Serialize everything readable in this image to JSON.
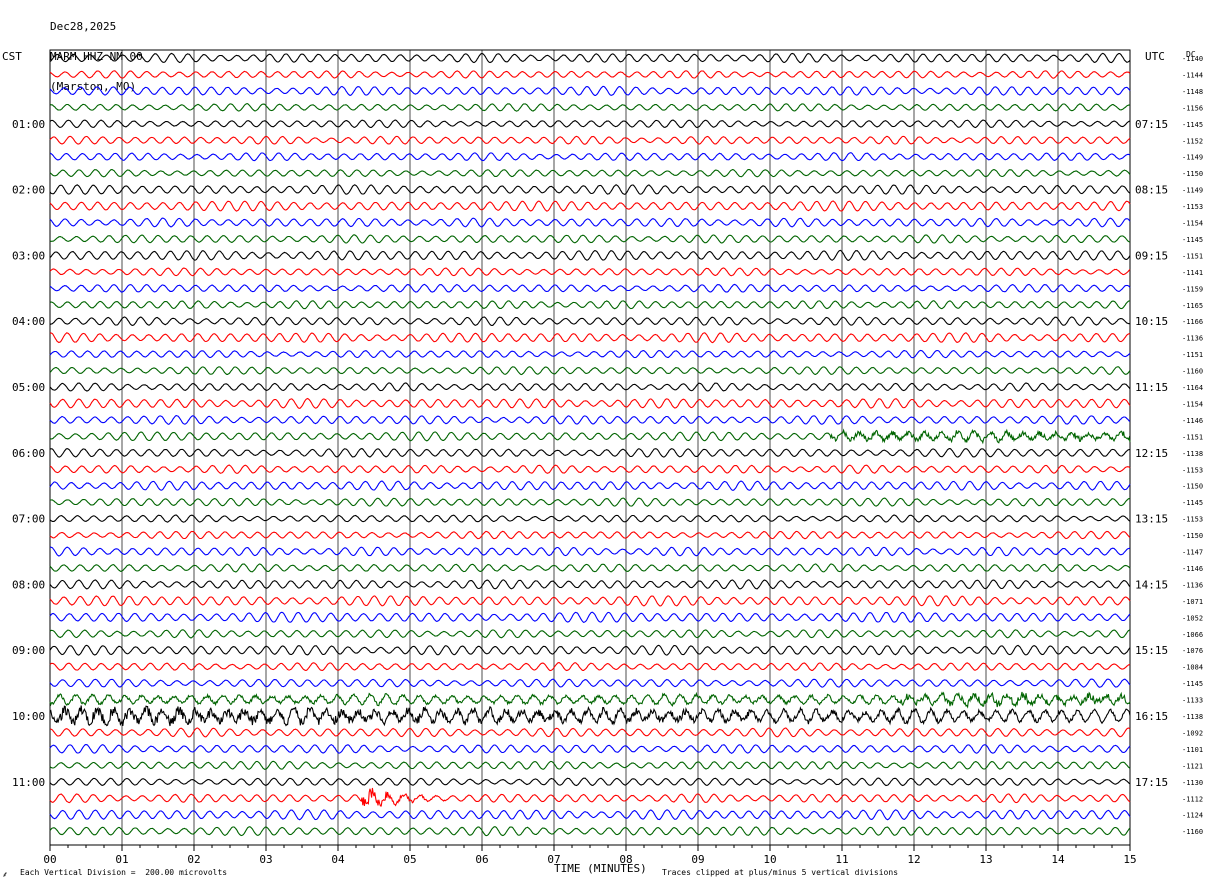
{
  "header": {
    "date": "Dec28,2025",
    "station": "MARM HHZ NM 00",
    "location": "(Marston, MO)"
  },
  "labels": {
    "left_tz": "CST",
    "right_tz": "UTC",
    "dc": "DC"
  },
  "footer": {
    "vertical_division": "Each Vertical Division =  200.00 microvolts",
    "xlabel": "TIME (MINUTES)",
    "clip_note": "Traces clipped at plus/minus 5 vertical divisions"
  },
  "chart_data": {
    "type": "line",
    "title": "Dec28,2025 MARM HHZ NM 00 (Marston, MO)",
    "xlabel": "TIME (MINUTES)",
    "xlim": [
      0,
      15
    ],
    "x_ticks": [
      "00",
      "01",
      "02",
      "03",
      "04",
      "05",
      "06",
      "07",
      "08",
      "09",
      "10",
      "11",
      "12",
      "13",
      "14",
      "15"
    ],
    "grid": "vertical lines at each minute",
    "trace_colors": [
      "#000000",
      "#ff0000",
      "#0000ff",
      "#006400"
    ],
    "left_time_labels": [
      "01:00",
      "02:00",
      "03:00",
      "04:00",
      "05:00",
      "06:00",
      "07:00",
      "08:00",
      "09:00",
      "10:00",
      "11:00"
    ],
    "right_time_labels": [
      "07:15",
      "08:15",
      "09:15",
      "10:15",
      "11:15",
      "12:15",
      "13:15",
      "14:15",
      "15:15",
      "16:15",
      "17:15"
    ],
    "dc_offsets": [
      "-1140",
      "-1144",
      "-1148",
      "-1156",
      "-1145",
      "-1152",
      "-1149",
      "-1150",
      "-1149",
      "-1153",
      "-1154",
      "-1145",
      "-1151",
      "-1141",
      "-1159",
      "-1165",
      "-1166",
      "-1136",
      "-1151",
      "-1160",
      "-1164",
      "-1154",
      "-1146",
      "-1151",
      "-1138",
      "-1153",
      "-1150",
      "-1145",
      "-1153",
      "-1150",
      "-1147",
      "-1146",
      "-1136",
      "-1071",
      "-1052",
      "-1066",
      "-1076",
      "-1084",
      "-1145",
      "-1133",
      "-1138",
      "-1092",
      "-1101",
      "-1121",
      "-1130",
      "-1112",
      "-1124",
      "-1160"
    ],
    "trace_count": 48,
    "events": [
      {
        "description": "strong broadband noise",
        "trace_range": [
          39,
          40
        ],
        "minutes": [
          0,
          15
        ]
      },
      {
        "description": "local event burst",
        "trace_index": 45,
        "minute": 4.4
      }
    ]
  }
}
